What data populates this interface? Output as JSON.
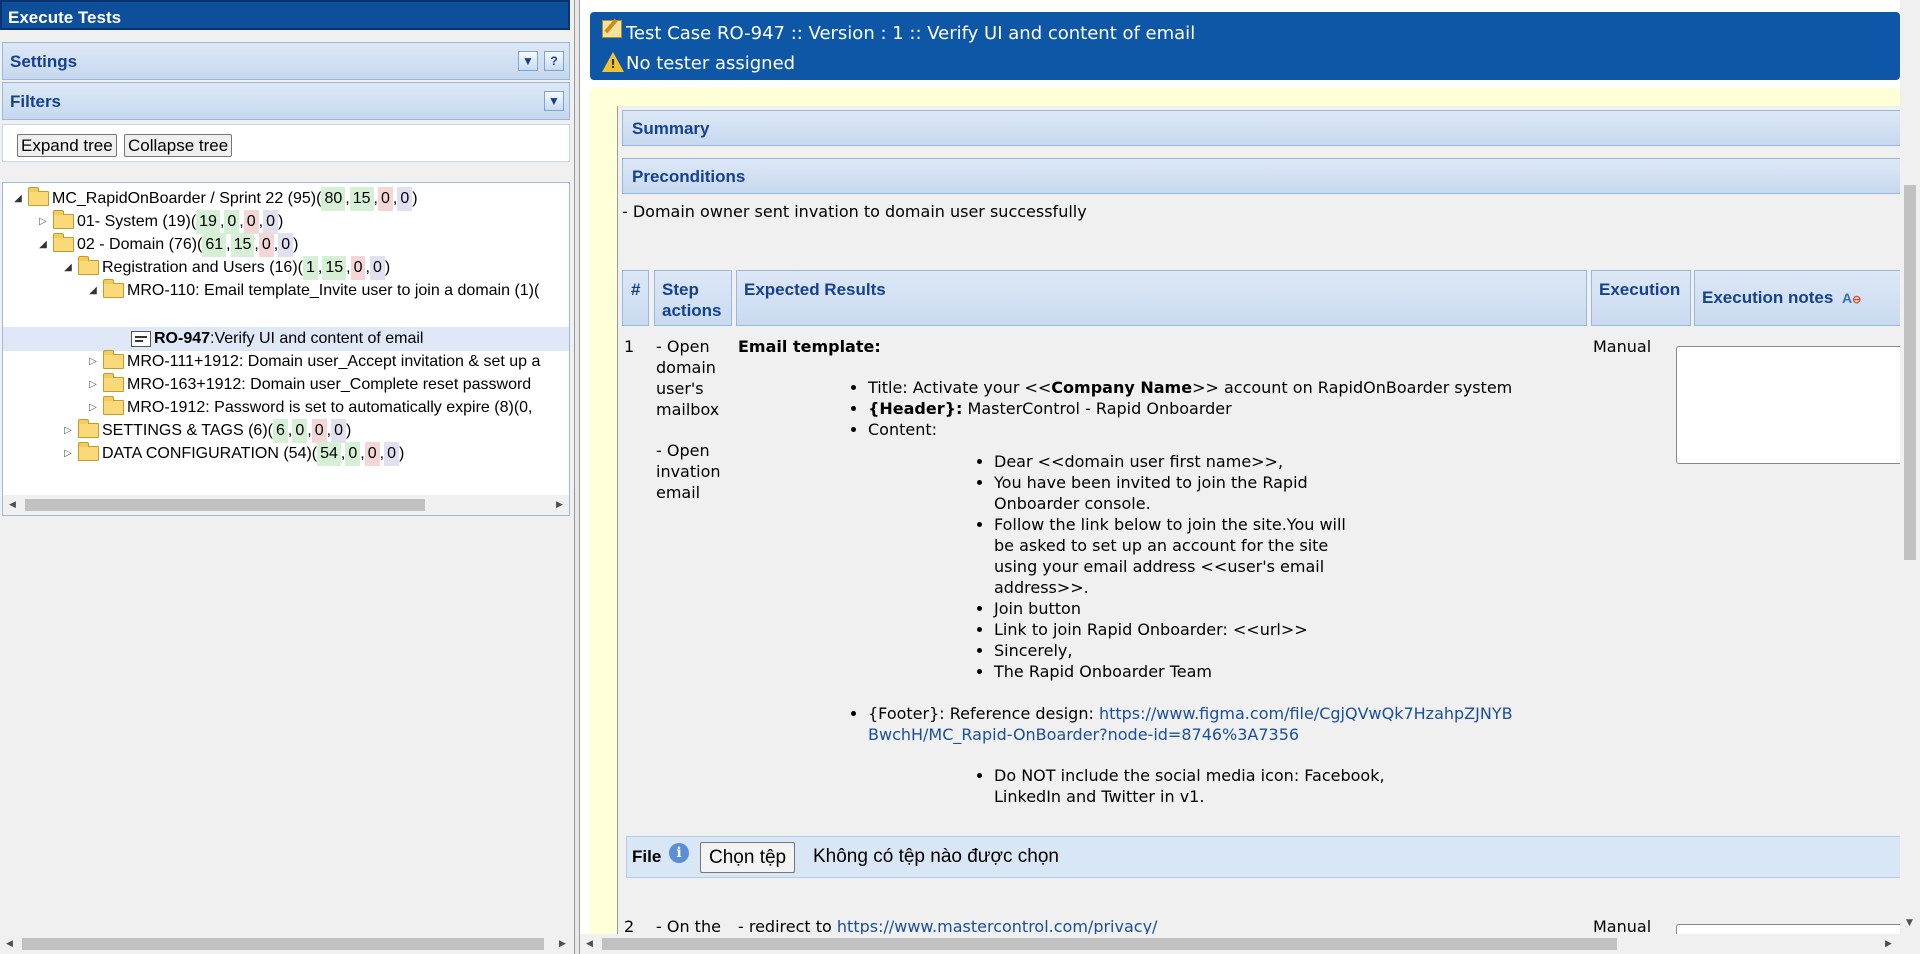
{
  "left": {
    "title": "Execute Tests",
    "settings_label": "Settings",
    "filters_label": "Filters",
    "expand_btn": "Expand tree",
    "collapse_btn": "Collapse tree",
    "tree": [
      {
        "label": "MC_RapidOnBoarder / Sprint 22 (95)(",
        "counts": [
          "80",
          "15",
          "0",
          "0"
        ]
      },
      {
        "label": "01- System (19)(",
        "counts": [
          "19",
          "0",
          "0",
          "0"
        ]
      },
      {
        "label": "02 - Domain (76)(",
        "counts": [
          "61",
          "15",
          "0",
          "0"
        ]
      },
      {
        "label": "Registration and Users (16)(",
        "counts": [
          "1",
          "15",
          "0",
          "0"
        ]
      },
      {
        "label": "MRO-110: Email template_Invite user to join a domain (1)("
      },
      {
        "id": "RO-947",
        "label": ":Verify UI and content of email"
      },
      {
        "label": "MRO-111+1912: Domain user_Accept invitation & set up a"
      },
      {
        "label": "MRO-163+1912: Domain user_Complete reset password"
      },
      {
        "label": "MRO-1912: Password is set to automatically expire (8)(0,"
      },
      {
        "label": "SETTINGS & TAGS (6)(",
        "counts": [
          "6",
          "0",
          "0",
          "0"
        ]
      },
      {
        "label": "DATA CONFIGURATION (54)(",
        "counts": [
          "54",
          "0",
          "0",
          "0"
        ]
      }
    ]
  },
  "header": {
    "title": "Test Case RO-947 :: Version : 1 :: Verify UI and content of email",
    "tester": "No tester assigned"
  },
  "sections": {
    "summary": "Summary",
    "preconditions": "Preconditions",
    "precondition_text": "- Domain owner sent invation to domain user successfully"
  },
  "table": {
    "col_num": "#",
    "col_step": "Step actions",
    "col_expected": "Expected Results",
    "col_exec": "Execution",
    "col_notes": "Execution notes"
  },
  "step1": {
    "num": "1",
    "action_a": "- Open domain user's mailbox",
    "action_b": "- Open invation email",
    "exec": "Manual",
    "heading": "Email template:",
    "title_pre": "Title: Activate your <<",
    "title_bold": "Company Name",
    "title_post": ">> account on RapidOnBoarder system",
    "header_bold": "{Header}:",
    "header_text": " MasterControl - Rapid Onboarder",
    "content_label": "Content:",
    "content_items": [
      "Dear <<domain user first name>>,",
      "You have been invited to join the Rapid Onboarder console.",
      "Follow the link below to join the site.You will be asked to set up an account for the site using your email address <<user's email address>>.",
      "Join button",
      "Link to join Rapid Onboarder: <<url>>",
      "Sincerely,",
      "The Rapid Onboarder Team"
    ],
    "footer_text": "{Footer}: Reference design: ",
    "footer_link": "https://www.figma.com/file/CgjQVwQk7HzahpZJNYBBwchH/MC_Rapid-OnBoarder?node-id=8746%3A7356",
    "social_note": "Do NOT include the social media icon: Facebook, LinkedIn and Twitter in v1."
  },
  "file": {
    "label": "File",
    "choose": "Chọn tệp",
    "status": "Không có tệp nào được chọn"
  },
  "step2": {
    "num": "2",
    "action": "- On the",
    "expected_pre": "- redirect to ",
    "expected_link": "https://www.mastercontrol.com/privacy/",
    "exec": "Manual"
  }
}
